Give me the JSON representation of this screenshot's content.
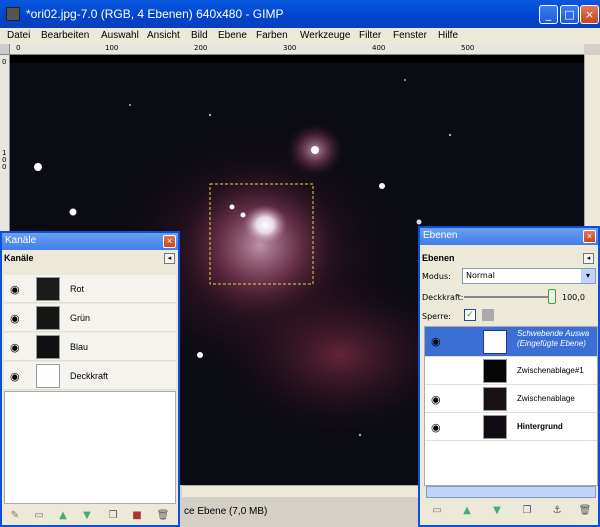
{
  "window": {
    "title": "*ori02.jpg-7.0 (RGB, 4 Ebenen) 640x480 - GIMP",
    "minimize": "_",
    "maximize": "□",
    "close": "×"
  },
  "menu": [
    "Datei",
    "Bearbeiten",
    "Auswahl",
    "Ansicht",
    "Bild",
    "Ebene",
    "Farben",
    "Werkzeuge",
    "Filter",
    "Fenster",
    "Hilfe"
  ],
  "ruler": {
    "h_labels": [
      "0",
      "100",
      "200",
      "300",
      "400",
      "500"
    ],
    "v_labels": [
      "0",
      "1 0 0"
    ]
  },
  "statusbar": {
    "text": "ce Ebene (7,0 MB)"
  },
  "channels_dock": {
    "title": "Kanäle",
    "tab_heading": "Kanäle",
    "rows": [
      {
        "label": "Rot"
      },
      {
        "label": "Grün"
      },
      {
        "label": "Blau"
      },
      {
        "label": "Deckkraft"
      }
    ]
  },
  "layers_dock": {
    "title": "Ebenen",
    "tab_heading": "Ebenen",
    "mode_label": "Modus:",
    "mode_value": "Normal",
    "opacity_label": "Deckkraft:",
    "opacity_value": "100,0",
    "lock_label": "Sperre:",
    "layers": [
      {
        "label": "Schwebende Auswa\n(Eingefügte Ebene)",
        "selected": true
      },
      {
        "label": "Zwischenablage#1"
      },
      {
        "label": "Zwischenablage"
      },
      {
        "label": "Hintergrund",
        "bold": true
      }
    ]
  },
  "colors": {
    "title_blue": "#0a58e0",
    "selection_blue": "#3b6fd6"
  }
}
